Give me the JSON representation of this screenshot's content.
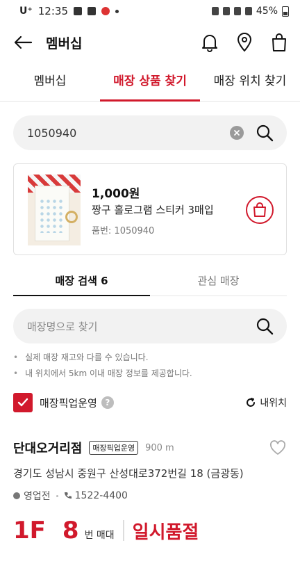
{
  "status_bar": {
    "carrier": "U⁺",
    "time": "12:35",
    "battery": "45%"
  },
  "header": {
    "title": "멤버십"
  },
  "tabs": [
    {
      "label": "멤버십"
    },
    {
      "label": "매장 상품 찾기"
    },
    {
      "label": "매장 위치 찾기"
    }
  ],
  "search": {
    "value": "1050940"
  },
  "product": {
    "price": "1,000원",
    "name": "짱구 홀로그램 스티커 3매입",
    "code": "품번: 1050940"
  },
  "sub_tabs": [
    {
      "label": "매장 검색 6"
    },
    {
      "label": "관심 매장"
    }
  ],
  "store_search": {
    "placeholder": "매장명으로 찾기"
  },
  "notes": [
    "실제 매장 재고와 다를 수 있습니다.",
    "내 위치에서 5km 이내 매장 정보를 제공합니다."
  ],
  "pickup_filter": {
    "label": "매장픽업운영",
    "help": "?",
    "my_location": "내위치",
    "checked": true
  },
  "store": {
    "name": "단대오거리점",
    "badge": "매장픽업운영",
    "distance": "900 m",
    "address": "경기도 성남시 중원구 산성대로372번길 18 (금광동)",
    "status": "영업전",
    "phone": "1522-4400",
    "floor": "1F",
    "shelf_number": "8",
    "shelf_unit": "번 매대",
    "stock_status": "일시품절"
  },
  "colors": {
    "accent": "#d1192c"
  }
}
